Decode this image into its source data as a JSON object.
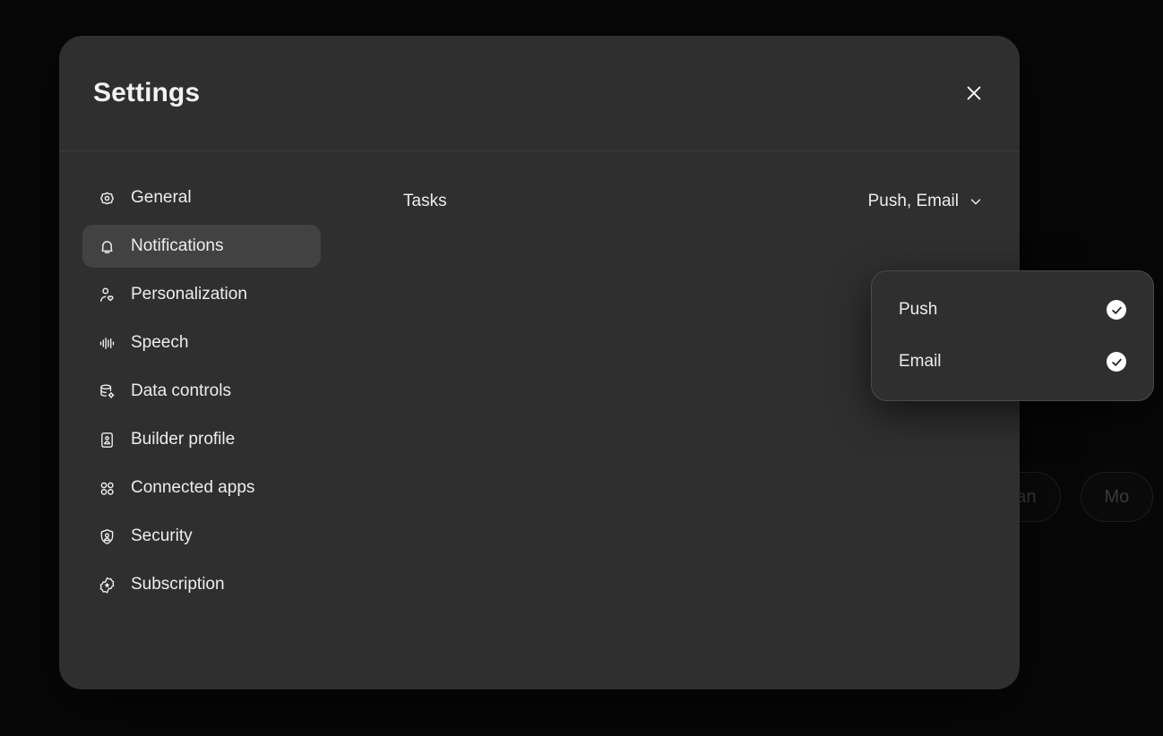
{
  "background": {
    "pills": [
      {
        "label": "a plan"
      },
      {
        "label": "Mo"
      }
    ]
  },
  "modal": {
    "title": "Settings",
    "close_label": "Close",
    "close_icon": "close-icon"
  },
  "sidebar": {
    "items": [
      {
        "label": "General",
        "icon": "gear-icon",
        "active": false
      },
      {
        "label": "Notifications",
        "icon": "bell-icon",
        "active": true
      },
      {
        "label": "Personalization",
        "icon": "person-heart-icon",
        "active": false
      },
      {
        "label": "Speech",
        "icon": "waveform-icon",
        "active": false
      },
      {
        "label": "Data controls",
        "icon": "database-gear-icon",
        "active": false
      },
      {
        "label": "Builder profile",
        "icon": "id-card-icon",
        "active": false
      },
      {
        "label": "Connected apps",
        "icon": "apps-grid-icon",
        "active": false
      },
      {
        "label": "Security",
        "icon": "shield-person-icon",
        "active": false
      },
      {
        "label": "Subscription",
        "icon": "badge-star-icon",
        "active": false
      }
    ]
  },
  "content": {
    "rows": [
      {
        "label": "Tasks",
        "value": "Push, Email",
        "chevron_icon": "chevron-down-icon"
      }
    ]
  },
  "dropdown": {
    "open": true,
    "options": [
      {
        "label": "Push",
        "checked": true,
        "icon": "check-circle-icon"
      },
      {
        "label": "Email",
        "checked": true,
        "icon": "check-circle-icon"
      }
    ]
  },
  "colors": {
    "page_background": "#070707",
    "modal_background": "#2f2f2f",
    "active_item_background": "#424242",
    "text_primary": "#ececec",
    "divider": "#3d3d3d",
    "check_badge": "#ffffff"
  }
}
